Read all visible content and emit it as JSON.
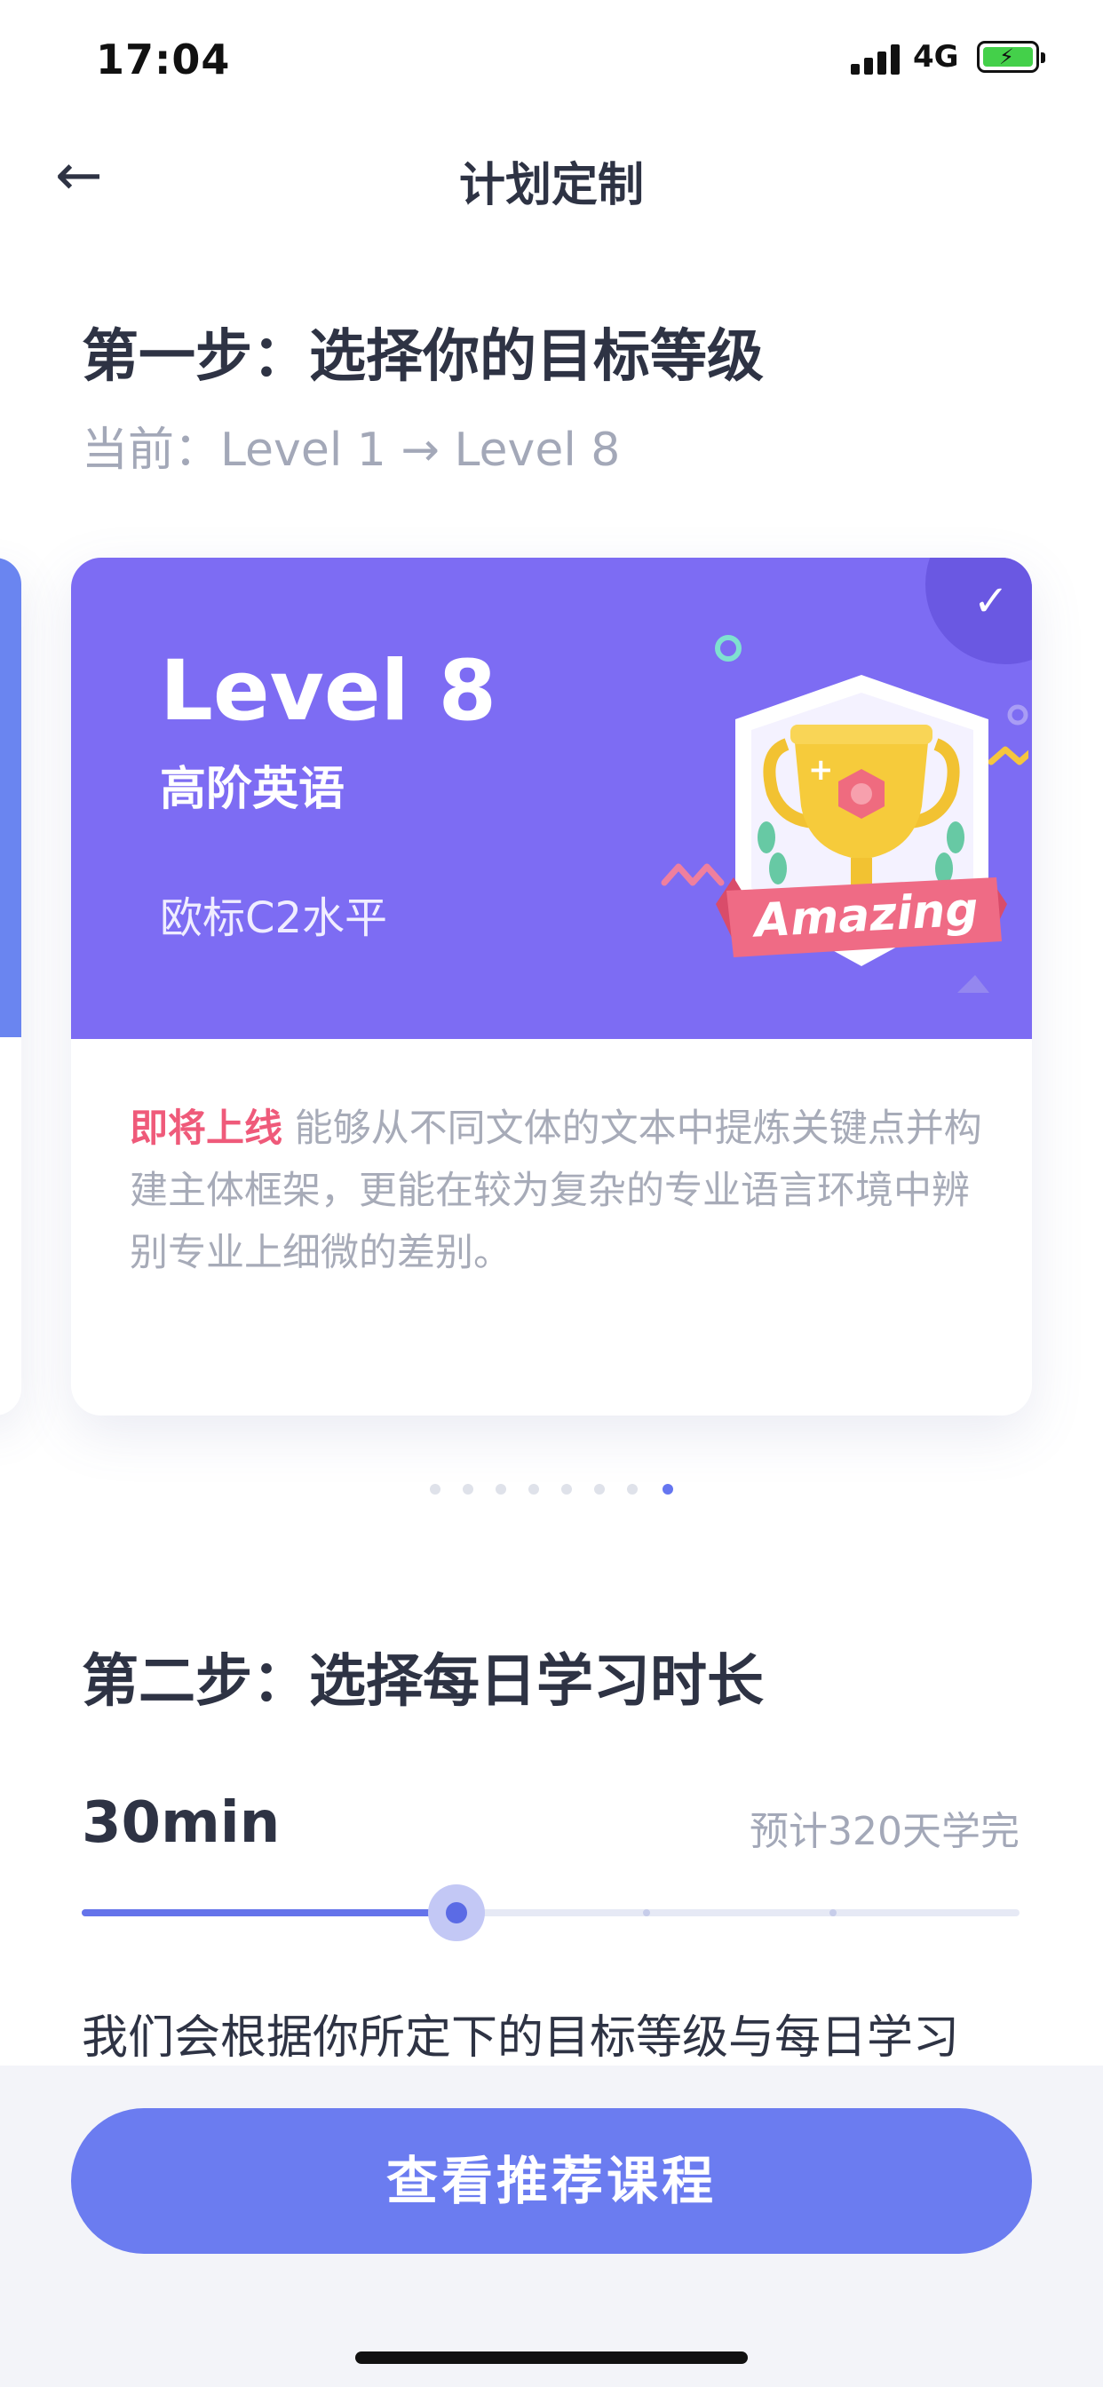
{
  "status_bar": {
    "time": "17:04",
    "network": "4G"
  },
  "nav": {
    "back_icon": "←",
    "title": "计划定制"
  },
  "step1": {
    "title": "第一步：选择你的目标等级",
    "current": "当前：Level 1 → Level 8"
  },
  "card": {
    "level": "Level 8",
    "name": "高阶英语",
    "standard": "欧标C2水平",
    "badge_text": "Amazing",
    "check_icon": "✓",
    "highlight": "即将上线",
    "description": " 能够从不同文体的文本中提炼关键点并构建主体框架，更能在较为复杂的专业语言环境中辨别专业上细微的差别。"
  },
  "pager": {
    "total": 8,
    "active_index": 8
  },
  "step2": {
    "title": "第二步：选择每日学习时长",
    "duration": "30min",
    "estimate": "预计320天学完",
    "slider_value": 0.4,
    "intro": "我们会根据你所定下的目标等级与每日学习"
  },
  "cta": {
    "label": "查看推荐课程"
  },
  "colors": {
    "accent": "#6b7cf0",
    "card_purple": "#7d6cf3",
    "highlight_red": "#ef5a7a",
    "muted_text": "#a3a8b8"
  }
}
